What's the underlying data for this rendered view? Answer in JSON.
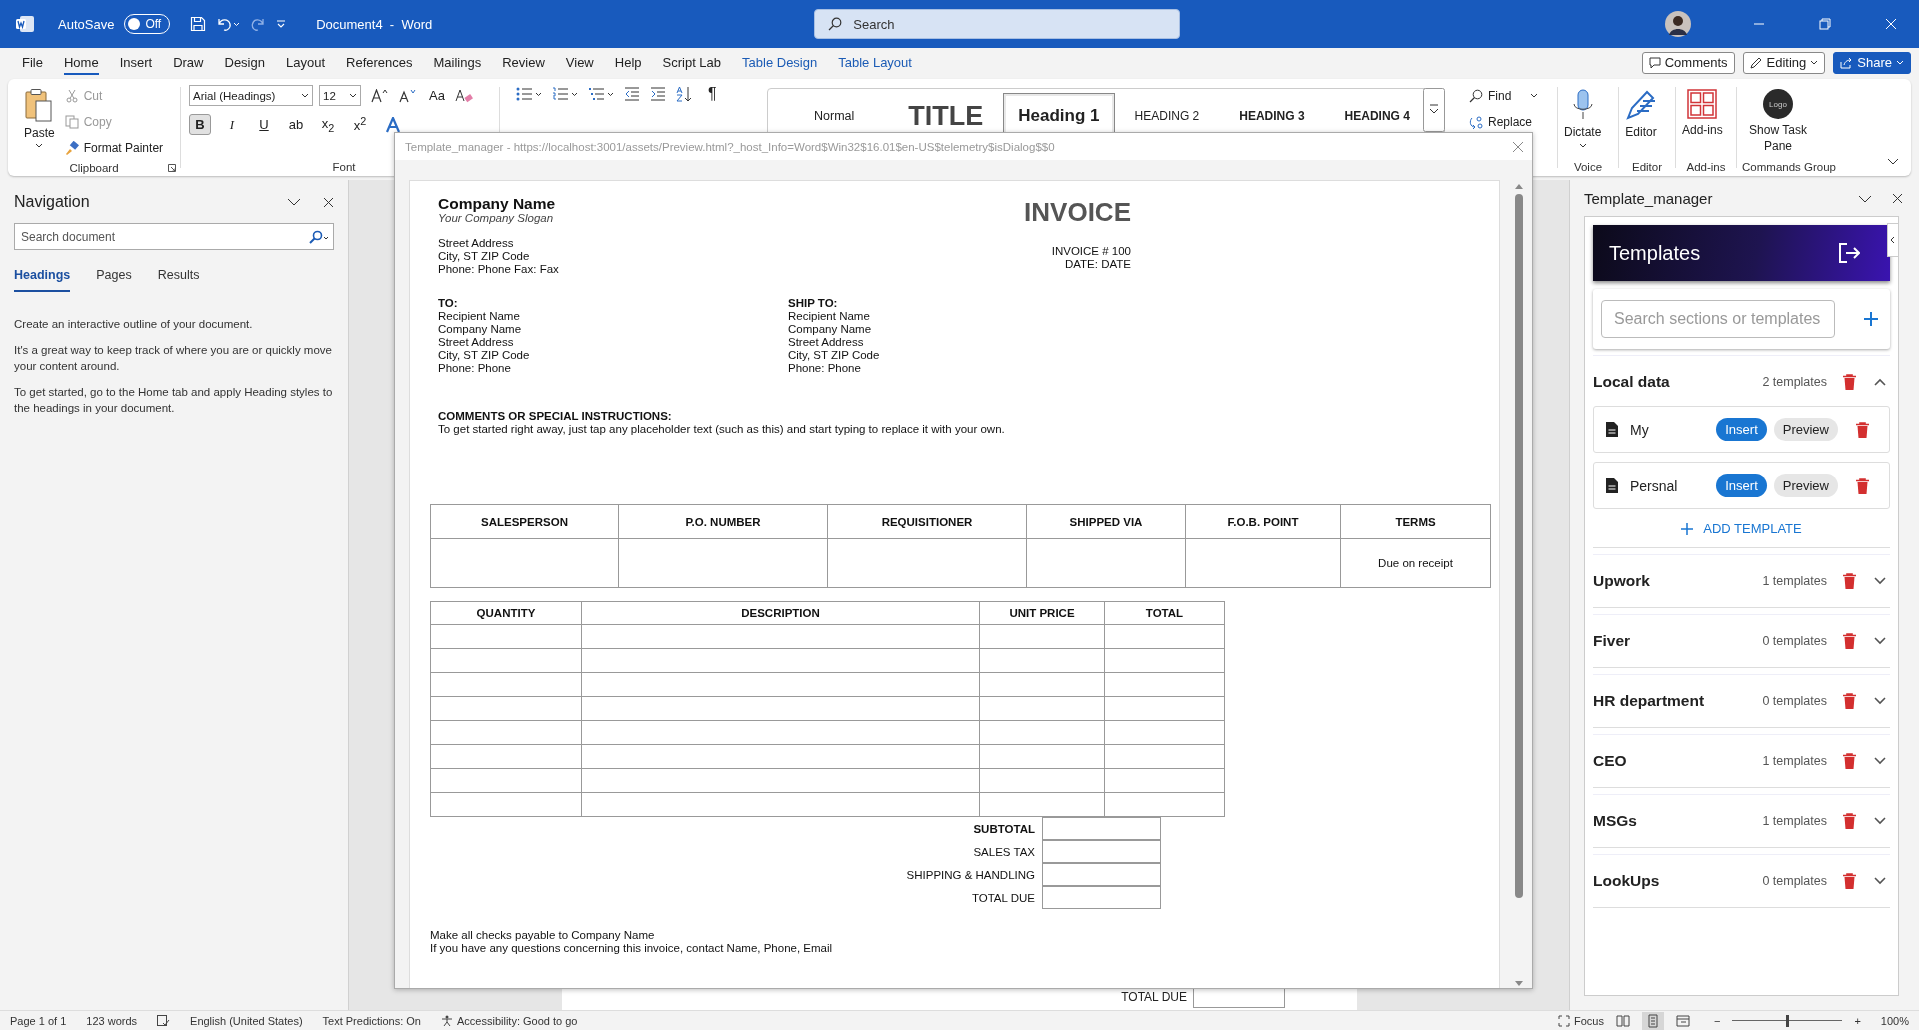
{
  "title_bar": {
    "autosave_label": "AutoSave",
    "autosave": {
      "on": false,
      "label": "Off"
    },
    "document_title": "Document4  -  Word",
    "search_placeholder": "Search"
  },
  "menu_tabs": [
    {
      "label": "File",
      "selected": false,
      "kind": "normal"
    },
    {
      "label": "Home",
      "selected": true,
      "kind": "normal"
    },
    {
      "label": "Insert",
      "selected": false,
      "kind": "normal"
    },
    {
      "label": "Draw",
      "selected": false,
      "kind": "normal"
    },
    {
      "label": "Design",
      "selected": false,
      "kind": "normal"
    },
    {
      "label": "Layout",
      "selected": false,
      "kind": "normal"
    },
    {
      "label": "References",
      "selected": false,
      "kind": "normal"
    },
    {
      "label": "Mailings",
      "selected": false,
      "kind": "normal"
    },
    {
      "label": "Review",
      "selected": false,
      "kind": "normal"
    },
    {
      "label": "View",
      "selected": false,
      "kind": "normal"
    },
    {
      "label": "Help",
      "selected": false,
      "kind": "normal"
    },
    {
      "label": "Script Lab",
      "selected": false,
      "kind": "normal"
    },
    {
      "label": "Table Design",
      "selected": false,
      "kind": "contextual"
    },
    {
      "label": "Table Layout",
      "selected": false,
      "kind": "contextual"
    }
  ],
  "top_actions": {
    "comments": "Comments",
    "editing": "Editing",
    "share": "Share"
  },
  "clipboard": {
    "paste": "Paste",
    "cut": "Cut",
    "copy": "Copy",
    "format_painter": "Format Painter",
    "label": "Clipboard"
  },
  "font": {
    "name": "Arial (Headings)",
    "size": "12",
    "case_button": "Aa",
    "label": "Font",
    "format_buttons": [
      {
        "label": "B",
        "selected": true
      },
      {
        "label": "I",
        "selected": false
      },
      {
        "label": "U",
        "selected": false
      },
      {
        "label": "ab",
        "selected": false
      },
      {
        "label": "x$_{2}$",
        "selected": false
      },
      {
        "label": "x$^{2}$",
        "selected": false
      }
    ]
  },
  "paragraph": {
    "pilcrow": "¶"
  },
  "styles": [
    {
      "label": "Normal",
      "selected": false,
      "kind": "normal"
    },
    {
      "label": "TITLE",
      "selected": false,
      "kind": "title"
    },
    {
      "label": "Heading 1",
      "selected": true,
      "kind": "h1"
    },
    {
      "label": "HEADING 2",
      "selected": false,
      "kind": "h2"
    },
    {
      "label": "HEADING 3",
      "selected": false,
      "kind": "h3"
    },
    {
      "label": "HEADING 4",
      "selected": false,
      "kind": "h3"
    }
  ],
  "editing": {
    "find": "Find",
    "replace": "Replace"
  },
  "ribbon_groups": [
    {
      "kind": "mic",
      "button": "Dictate",
      "label": "Voice"
    },
    {
      "kind": "pen",
      "button": "Editor",
      "label": "Editor"
    },
    {
      "kind": "grid",
      "button": "Add-ins",
      "label": "Add-ins"
    },
    {
      "kind": "logo",
      "logo": "Logo",
      "button": "Show Task Pane",
      "label": "Commands Group"
    }
  ],
  "navigation": {
    "title": "Navigation",
    "search_placeholder": "Search document",
    "tabs": [
      {
        "label": "Headings",
        "selected": true
      },
      {
        "label": "Pages",
        "selected": false
      },
      {
        "label": "Results",
        "selected": false
      }
    ],
    "paragraphs": [
      "Create an interactive outline of your document.",
      "It's a great way to keep track of where you are or quickly move your content around.",
      "To get started, go to the Home tab and apply Heading styles to the headings in your document."
    ]
  },
  "background_document": {
    "total_due_label": "TOTAL DUE"
  },
  "dialog": {
    "title": "Template_manager - https://localhost:3001/assets/Preview.html?_host_Info=Word$Win32$16.01$en-US$telemetry$isDialog$$0",
    "invoice": {
      "company": "Company Name",
      "slogan": "Your Company Slogan",
      "heading": "INVOICE",
      "address": [
        "Street Address",
        "City, ST ZIP Code",
        "Phone: Phone Fax: Fax"
      ],
      "meta": [
        "INVOICE # 100",
        "DATE: DATE"
      ],
      "to": {
        "label": "TO:",
        "lines": [
          "Recipient Name",
          "Company Name",
          "Street Address",
          "City, ST ZIP Code",
          "Phone: Phone"
        ]
      },
      "ship_to": {
        "label": "SHIP TO:",
        "lines": [
          "Recipient Name",
          "Company Name",
          "Street Address",
          "City, ST ZIP Code",
          "Phone: Phone"
        ]
      },
      "comments_label": "COMMENTS OR SPECIAL INSTRUCTIONS:",
      "comments": "To get started right away, just tap any placeholder text (such as this) and start typing to replace it with your own.",
      "order_table": {
        "columns": [
          "SALESPERSON",
          "P.O. NUMBER",
          "REQUISITIONER",
          "SHIPPED VIA",
          "F.O.B. POINT",
          "TERMS"
        ],
        "terms_value": "Due on receipt"
      },
      "items_table": {
        "columns": [
          "QUANTITY",
          "DESCRIPTION",
          "UNIT PRICE",
          "TOTAL"
        ]
      },
      "totals": [
        "SUBTOTAL",
        "SALES TAX",
        "SHIPPING & HANDLING",
        "TOTAL DUE"
      ],
      "footer": [
        "Make all checks payable to Company Name",
        "If you have any questions concerning this invoice, contact Name, Phone, Email"
      ]
    }
  },
  "task_pane": {
    "title": "Template_manager",
    "header": "Templates",
    "search_placeholder": "Search sections or templates",
    "sections": [
      {
        "title": "Local data",
        "count": "2 templates",
        "expanded": true,
        "templates": [
          {
            "name": "My",
            "insert": "Insert",
            "preview": "Preview"
          },
          {
            "name": "Persnal",
            "insert": "Insert",
            "preview": "Preview"
          }
        ],
        "add_label": "ADD TEMPLATE"
      },
      {
        "title": "Upwork",
        "count": "1 templates",
        "expanded": false
      },
      {
        "title": "Fiver",
        "count": "0 templates",
        "expanded": false
      },
      {
        "title": "HR department",
        "count": "0 templates",
        "expanded": false
      },
      {
        "title": "CEO",
        "count": "1 templates",
        "expanded": false
      },
      {
        "title": "MSGs",
        "count": "1 templates",
        "expanded": false
      },
      {
        "title": "LookUps",
        "count": "0 templates",
        "expanded": false
      }
    ]
  },
  "status_bar": {
    "left": [
      "Page 1 of 1",
      "123 words"
    ],
    "language": "English (United States)",
    "predictions": "Text Predictions: On",
    "accessibility": "Accessibility: Good to go",
    "focus": "Focus",
    "views": [
      {
        "kind": "read",
        "selected": false
      },
      {
        "kind": "print",
        "selected": true
      },
      {
        "kind": "web",
        "selected": false
      }
    ],
    "minus": "−",
    "plus": "+",
    "zoom": {
      "level": 0.5
    },
    "zoom_label": "100%"
  }
}
